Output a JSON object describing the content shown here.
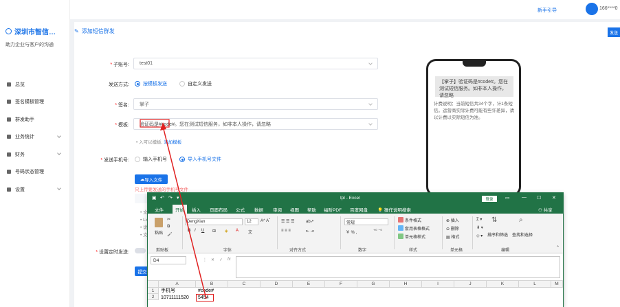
{
  "topbar": {
    "link": "新手引导",
    "user": "166****0"
  },
  "sidebar": {
    "brand": "深圳市智信…",
    "subtitle": "助力企业与客户的沟通",
    "items": [
      {
        "label": "总览",
        "icon": "home-icon"
      },
      {
        "label": "签名模板管理",
        "icon": "template-icon"
      },
      {
        "label": "群发助手",
        "icon": "send-icon"
      },
      {
        "label": "业务统计",
        "icon": "chart-icon",
        "arrow": true
      },
      {
        "label": "财务",
        "icon": "wallet-icon",
        "arrow": true
      },
      {
        "label": "号码状态管理",
        "icon": "phone-icon"
      },
      {
        "label": "设置",
        "icon": "settings-icon",
        "arrow": true
      }
    ]
  },
  "page": {
    "title": "添加短信群发",
    "send_button": "发送"
  },
  "form": {
    "sub_account_label": "子账号",
    "sub_account_value": "test01",
    "send_mode_label": "发送方式",
    "send_mode_options": [
      "按模板发送",
      "自定义发送"
    ],
    "sign_label": "签名",
    "sign_value": "掌子",
    "template_label": "模板",
    "template_value": "验证码是#code#。您在测试短信服务，如非本人操作，请忽略",
    "template_hint": "• 入可以模板,",
    "template_link": "添加模板",
    "phone_label": "发送手机号",
    "phone_options": [
      "输入手机号",
      "导入手机号文件"
    ],
    "upload_button": "导入文件",
    "upload_warning": "只上传要发送的手机号文件",
    "file_notes": [
      "• 文件",
      "• Lx",
      "• 说明",
      "• 文件"
    ],
    "schedule_label": "设置定时发送",
    "submit_button": "提交"
  },
  "phone_preview": {
    "message": "【掌子】验证码是#code#。您在测试短信服务。如非本人操作，请忽略",
    "note": "计费说明：当前短信共34个字，计1条短信。运营商实际计费可能有些许差异，请以计费以实际短信为准。"
  },
  "excel": {
    "filename": "tpl  -  Excel",
    "login": "登录",
    "tabs": [
      "文件",
      "开始",
      "插入",
      "页面布局",
      "公式",
      "数据",
      "审阅",
      "视图",
      "帮助",
      "福昕PDF",
      "百度网盘",
      "操作说明搜索"
    ],
    "share": "共享",
    "font_name": "DengXian",
    "font_size": "12",
    "number_format": "常规",
    "ribbon_labels": [
      "剪贴板",
      "字体",
      "对齐方式",
      "数字",
      "样式",
      "单元格",
      "编辑"
    ],
    "ribbon_items": [
      "条件格式",
      "套用表格格式",
      "单元格样式",
      "插入",
      "删除",
      "格式",
      "排序和筛选",
      "查找和选择",
      "粘贴"
    ],
    "name_box": "D4",
    "columns": [
      "A",
      "B",
      "C",
      "D",
      "E",
      "F",
      "G",
      "H",
      "I",
      "J",
      "K",
      "L",
      "M"
    ],
    "rows": [
      "1",
      "2"
    ],
    "cells": {
      "A1": "手机号",
      "B1": "#code#",
      "A2": "10711111520",
      "B2": "5454"
    }
  }
}
